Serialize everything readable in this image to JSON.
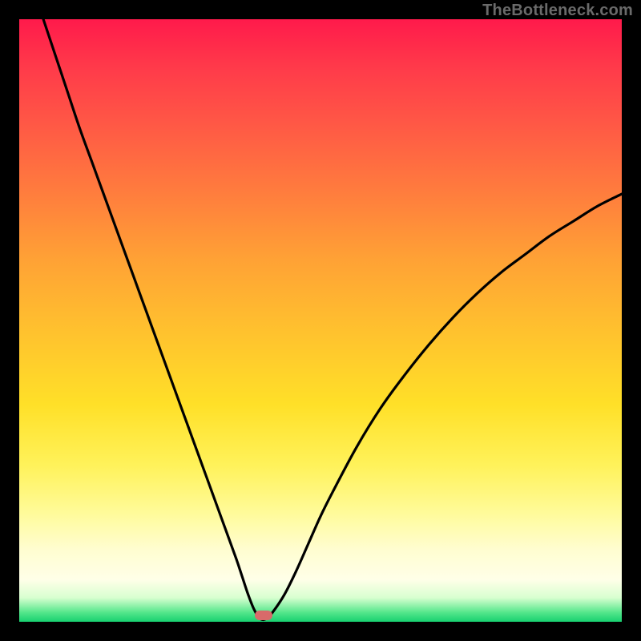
{
  "watermark": {
    "text": "TheBottleneck.com"
  },
  "colors": {
    "background": "#000000",
    "curve_stroke": "#000000",
    "marker_fill": "#d86a6a"
  },
  "plot": {
    "inner_width": 752,
    "inner_height": 752,
    "offset_x": 24,
    "offset_y": 24
  },
  "chart_data": {
    "type": "line",
    "title": "",
    "xlabel": "",
    "ylabel": "",
    "xlim": [
      0,
      100
    ],
    "ylim": [
      0,
      100
    ],
    "grid": false,
    "legend": false,
    "series": [
      {
        "name": "bottleneck-curve",
        "x": [
          4,
          6,
          8,
          10,
          12,
          14,
          16,
          18,
          20,
          22,
          24,
          26,
          28,
          30,
          32,
          34,
          36,
          37,
          38,
          39,
          40,
          41,
          42,
          44,
          46,
          48,
          50,
          52,
          56,
          60,
          64,
          68,
          72,
          76,
          80,
          84,
          88,
          92,
          96,
          100
        ],
        "y": [
          100,
          94,
          88,
          82,
          76.5,
          71,
          65.5,
          60,
          54.5,
          49,
          43.5,
          38,
          32.5,
          27,
          21.5,
          16,
          10.5,
          7.5,
          4.5,
          2,
          0.5,
          0.5,
          1.5,
          4.5,
          8.5,
          13,
          17.5,
          21.5,
          29,
          35.5,
          41,
          46,
          50.5,
          54.5,
          58,
          61,
          64,
          66.5,
          69,
          71
        ]
      }
    ],
    "marker": {
      "x": 40.5,
      "y": 1,
      "shape": "rounded-rect",
      "color": "#d86a6a"
    },
    "annotations": [
      {
        "text": "TheBottleneck.com",
        "position": "top-right",
        "color": "#6a6a6a"
      }
    ]
  }
}
